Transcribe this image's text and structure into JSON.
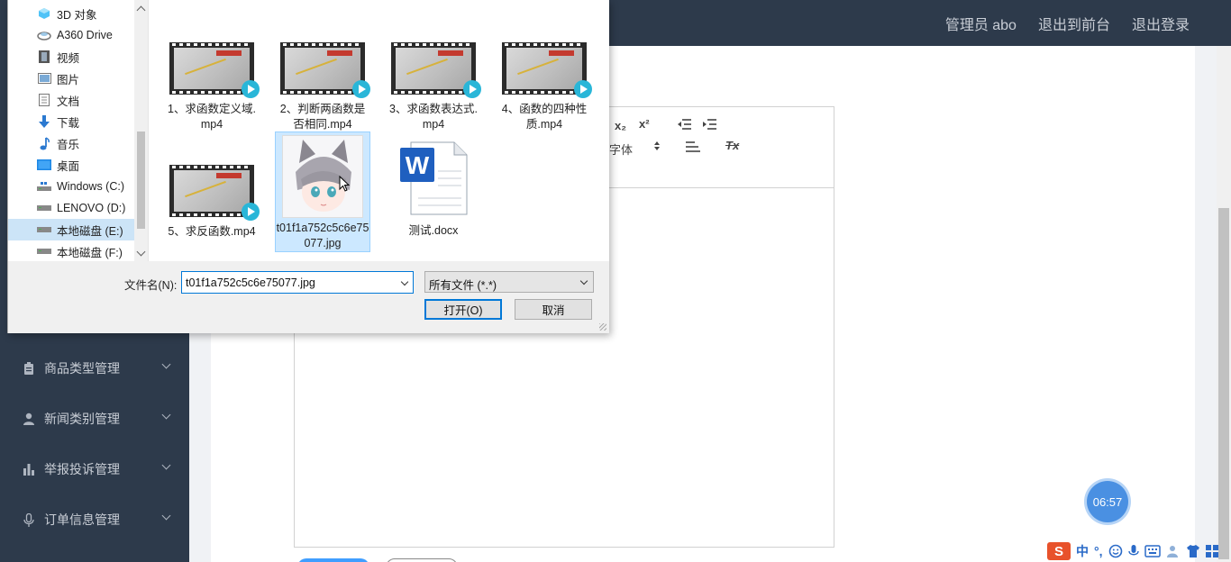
{
  "header": {
    "admin_label": "管理员 abo",
    "to_front_label": "退出到前台",
    "logout_label": "退出登录"
  },
  "sidebar": {
    "items": [
      {
        "label": "商品类型管理",
        "icon": "clipboard-icon"
      },
      {
        "label": "新闻类别管理",
        "icon": "user-icon"
      },
      {
        "label": "举报投诉管理",
        "icon": "bar-chart-icon"
      },
      {
        "label": "订单信息管理",
        "icon": "microphone-icon"
      }
    ]
  },
  "editor": {
    "sub_label": "x₂",
    "sup_label": "x²",
    "font_label": "字体",
    "clear_format_label": "Tx"
  },
  "timer": {
    "value": "06:57"
  },
  "tray": {
    "ime_logo": "S",
    "ime_mode": "中"
  },
  "dialog": {
    "nav": [
      {
        "label": "3D 对象",
        "icon": "3d-object-icon"
      },
      {
        "label": "A360 Drive",
        "icon": "cloud-drive-icon"
      },
      {
        "label": "视频",
        "icon": "video-folder-icon"
      },
      {
        "label": "图片",
        "icon": "pictures-folder-icon"
      },
      {
        "label": "文档",
        "icon": "documents-folder-icon"
      },
      {
        "label": "下载",
        "icon": "download-icon"
      },
      {
        "label": "音乐",
        "icon": "music-icon"
      },
      {
        "label": "桌面",
        "icon": "desktop-icon"
      },
      {
        "label": "Windows (C:)",
        "icon": "drive-icon"
      },
      {
        "label": "LENOVO (D:)",
        "icon": "drive-icon"
      },
      {
        "label": "本地磁盘 (E:)",
        "icon": "drive-icon",
        "selected": true
      },
      {
        "label": "本地磁盘 (F:)",
        "icon": "drive-icon"
      }
    ],
    "files": [
      {
        "name": "1、求函数定义域.mp4",
        "type": "video"
      },
      {
        "name": "2、判断两函数是否相同.mp4",
        "type": "video"
      },
      {
        "name": "3、求函数表达式.mp4",
        "type": "video"
      },
      {
        "name": "4、函数的四种性质.mp4",
        "type": "video"
      },
      {
        "name": "5、求反函数.mp4",
        "type": "video"
      },
      {
        "name": "t01f1a752c5c6e75077.jpg",
        "type": "image",
        "selected": true
      },
      {
        "name": "测试.docx",
        "type": "word"
      }
    ],
    "filename_label": "文件名(N):",
    "filename_value": "t01f1a752c5c6e75077.jpg",
    "filter_value": "所有文件 (*.*)",
    "open_label": "打开(O)",
    "cancel_label": "取消"
  },
  "colors": {
    "sidebar_bg": "#2d3a4b",
    "accent": "#409eff",
    "selection": "#cce8ff"
  }
}
